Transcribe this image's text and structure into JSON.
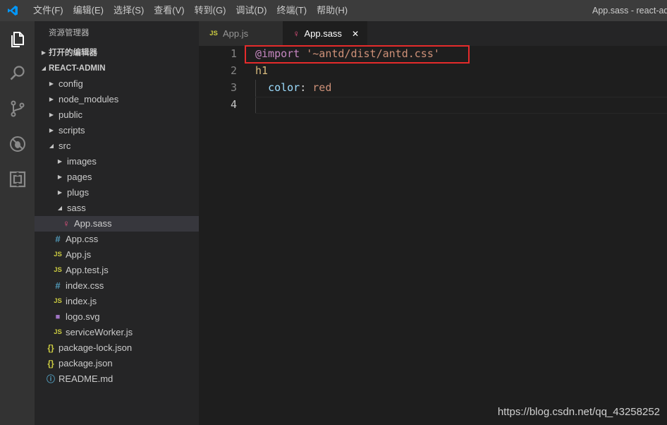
{
  "titlebar": {
    "menu": [
      "文件(F)",
      "编辑(E)",
      "选择(S)",
      "查看(V)",
      "转到(G)",
      "调试(D)",
      "终端(T)",
      "帮助(H)"
    ],
    "window_title": "App.sass - react-admin"
  },
  "activitybar": {
    "icons": [
      "explorer-icon",
      "search-icon",
      "source-control-icon",
      "debug-icon",
      "extensions-icon"
    ]
  },
  "sidebar": {
    "title": "资源管理器",
    "open_editors_label": "打开的编辑器",
    "project_label": "REACT-ADMIN",
    "tree": [
      {
        "label": "config",
        "type": "folder",
        "depth": 1,
        "expanded": false
      },
      {
        "label": "node_modules",
        "type": "folder",
        "depth": 1,
        "expanded": false
      },
      {
        "label": "public",
        "type": "folder",
        "depth": 1,
        "expanded": false
      },
      {
        "label": "scripts",
        "type": "folder",
        "depth": 1,
        "expanded": false
      },
      {
        "label": "src",
        "type": "folder",
        "depth": 1,
        "expanded": true
      },
      {
        "label": "images",
        "type": "folder",
        "depth": 2,
        "expanded": false
      },
      {
        "label": "pages",
        "type": "folder",
        "depth": 2,
        "expanded": false
      },
      {
        "label": "plugs",
        "type": "folder",
        "depth": 2,
        "expanded": false
      },
      {
        "label": "sass",
        "type": "folder",
        "depth": 2,
        "expanded": true
      },
      {
        "label": "App.sass",
        "type": "sass",
        "depth": 3,
        "selected": true
      },
      {
        "label": "App.css",
        "type": "css",
        "depth": 2
      },
      {
        "label": "App.js",
        "type": "js",
        "depth": 2
      },
      {
        "label": "App.test.js",
        "type": "js",
        "depth": 2
      },
      {
        "label": "index.css",
        "type": "css",
        "depth": 2
      },
      {
        "label": "index.js",
        "type": "js",
        "depth": 2
      },
      {
        "label": "logo.svg",
        "type": "svg",
        "depth": 2
      },
      {
        "label": "serviceWorker.js",
        "type": "js",
        "depth": 2
      },
      {
        "label": "package-lock.json",
        "type": "json",
        "depth": 1
      },
      {
        "label": "package.json",
        "type": "json",
        "depth": 1
      },
      {
        "label": "README.md",
        "type": "info",
        "depth": 1
      }
    ]
  },
  "tabs": [
    {
      "label": "App.js",
      "type": "js",
      "active": false
    },
    {
      "label": "App.sass",
      "type": "sass",
      "active": true
    }
  ],
  "icons": {
    "js": "JS",
    "css": "#",
    "json": "{}",
    "info": "ⓘ",
    "sass": "♀",
    "svg": "■",
    "close": "✕"
  },
  "editor": {
    "lines": [
      {
        "num": "1",
        "tokens": [
          {
            "t": "@import",
            "c": "kw"
          },
          {
            "t": " ",
            "c": "punc"
          },
          {
            "t": "'~antd/dist/antd.css'",
            "c": "str"
          }
        ]
      },
      {
        "num": "2",
        "tokens": [
          {
            "t": "h1",
            "c": "tag"
          }
        ]
      },
      {
        "num": "3",
        "tokens": [
          {
            "t": "  ",
            "c": "punc"
          },
          {
            "t": "color",
            "c": "prop"
          },
          {
            "t": ": ",
            "c": "punc"
          },
          {
            "t": "red",
            "c": "str"
          }
        ]
      },
      {
        "num": "4",
        "tokens": []
      }
    ],
    "current_line": "4"
  },
  "watermark": "https://blog.csdn.net/qq_43258252",
  "colors": {
    "highlight_box": "#e52b2b",
    "accent": "#007acc"
  }
}
